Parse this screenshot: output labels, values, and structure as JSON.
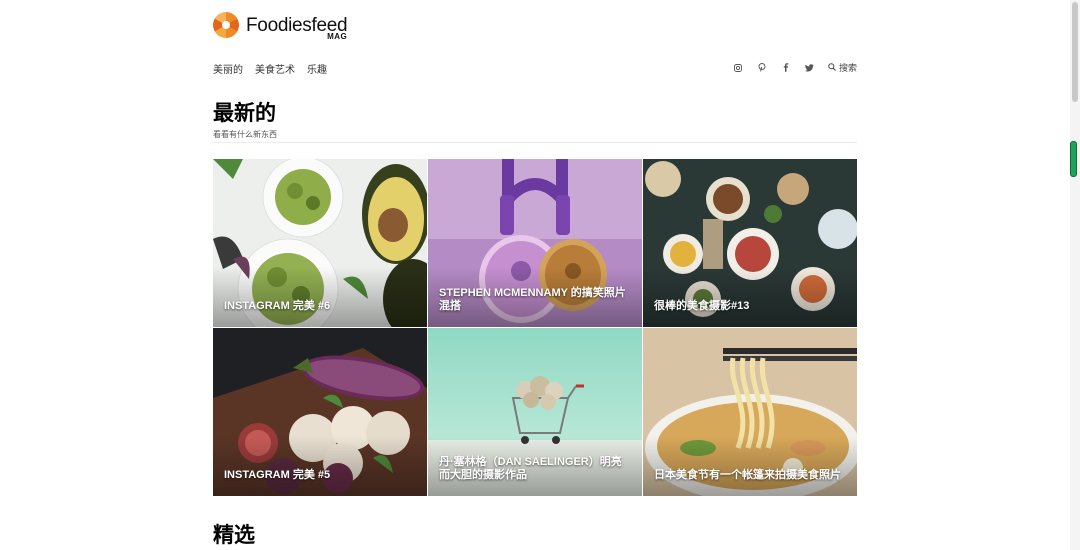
{
  "brand": {
    "name": "Foodiesfeed",
    "sub": "MAG"
  },
  "nav": [
    {
      "label": "美丽的"
    },
    {
      "label": "美食艺术"
    },
    {
      "label": "乐趣"
    }
  ],
  "social": {
    "icons": [
      "instagram-icon",
      "pinterest-icon",
      "facebook-icon",
      "twitter-icon"
    ],
    "search_label": "搜索"
  },
  "latest": {
    "title": "最新的",
    "subtitle": "看看有什么新东西",
    "cards": [
      {
        "caption": "INSTAGRAM 完美 #6"
      },
      {
        "caption": "STEPHEN MCMENNAMY 的搞笑照片混搭"
      },
      {
        "caption": "很棒的美食摄影#13"
      },
      {
        "caption": "INSTAGRAM 完美 #5"
      },
      {
        "caption": "丹·塞林格（DAN SAELINGER）明亮而大胆的摄影作品"
      },
      {
        "caption": "日本美食节有一个帐篷来拍摄美食照片"
      }
    ]
  },
  "featured": {
    "title": "精选"
  },
  "colors": {
    "logo_orange": "#f08a24",
    "green_tab": "#1fa35a"
  }
}
